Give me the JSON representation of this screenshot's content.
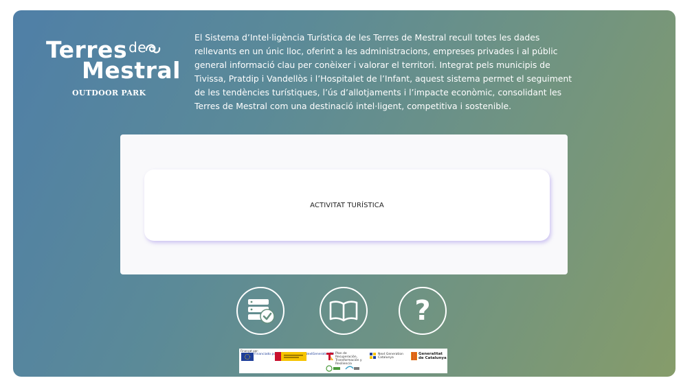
{
  "logo": {
    "line1": "Terres",
    "de": "de",
    "line2": "Mestral",
    "subtitle": "OUTDOOR PARK"
  },
  "intro_text": "El Sistema d’Intel·ligència Turística de les Terres de Mestral recull totes les dades rellevants en un únic lloc, oferint a les administracions, empreses privades i al públic general informació clau per conèixer i valorar el territori. Integrat pels municipis de Tivissa, Pratdip i Vandellòs i l’Hospitalet de l’Infant, aquest sistema permet el seguiment de les tendències turístiques, l’ús d’allotjaments i l’impacte econòmic, consolidant les Terres de Mestral com una destinació intel·ligent, competitiva i sostenible.",
  "main_card": {
    "label": "ACTIVITAT TURÍSTICA"
  },
  "nav_buttons": [
    {
      "icon": "database-check-icon"
    },
    {
      "icon": "open-book-icon"
    },
    {
      "icon": "question-mark-icon",
      "glyph": "?"
    }
  ],
  "funding": {
    "financed_by": "Finançat per:",
    "eu_text": "Financiado por la Unión Europea NextGenerationEU",
    "recovery_plan": "Plan de Recuperación, Transformación y Resiliencia",
    "next_generation": "Next Generation Catalunya",
    "generalitat": "Generalitat de Catalunya"
  },
  "colors": {
    "gradient_start": "#4f7fa7",
    "gradient_end": "#869c6a",
    "card_shadow": "#9682e6"
  }
}
